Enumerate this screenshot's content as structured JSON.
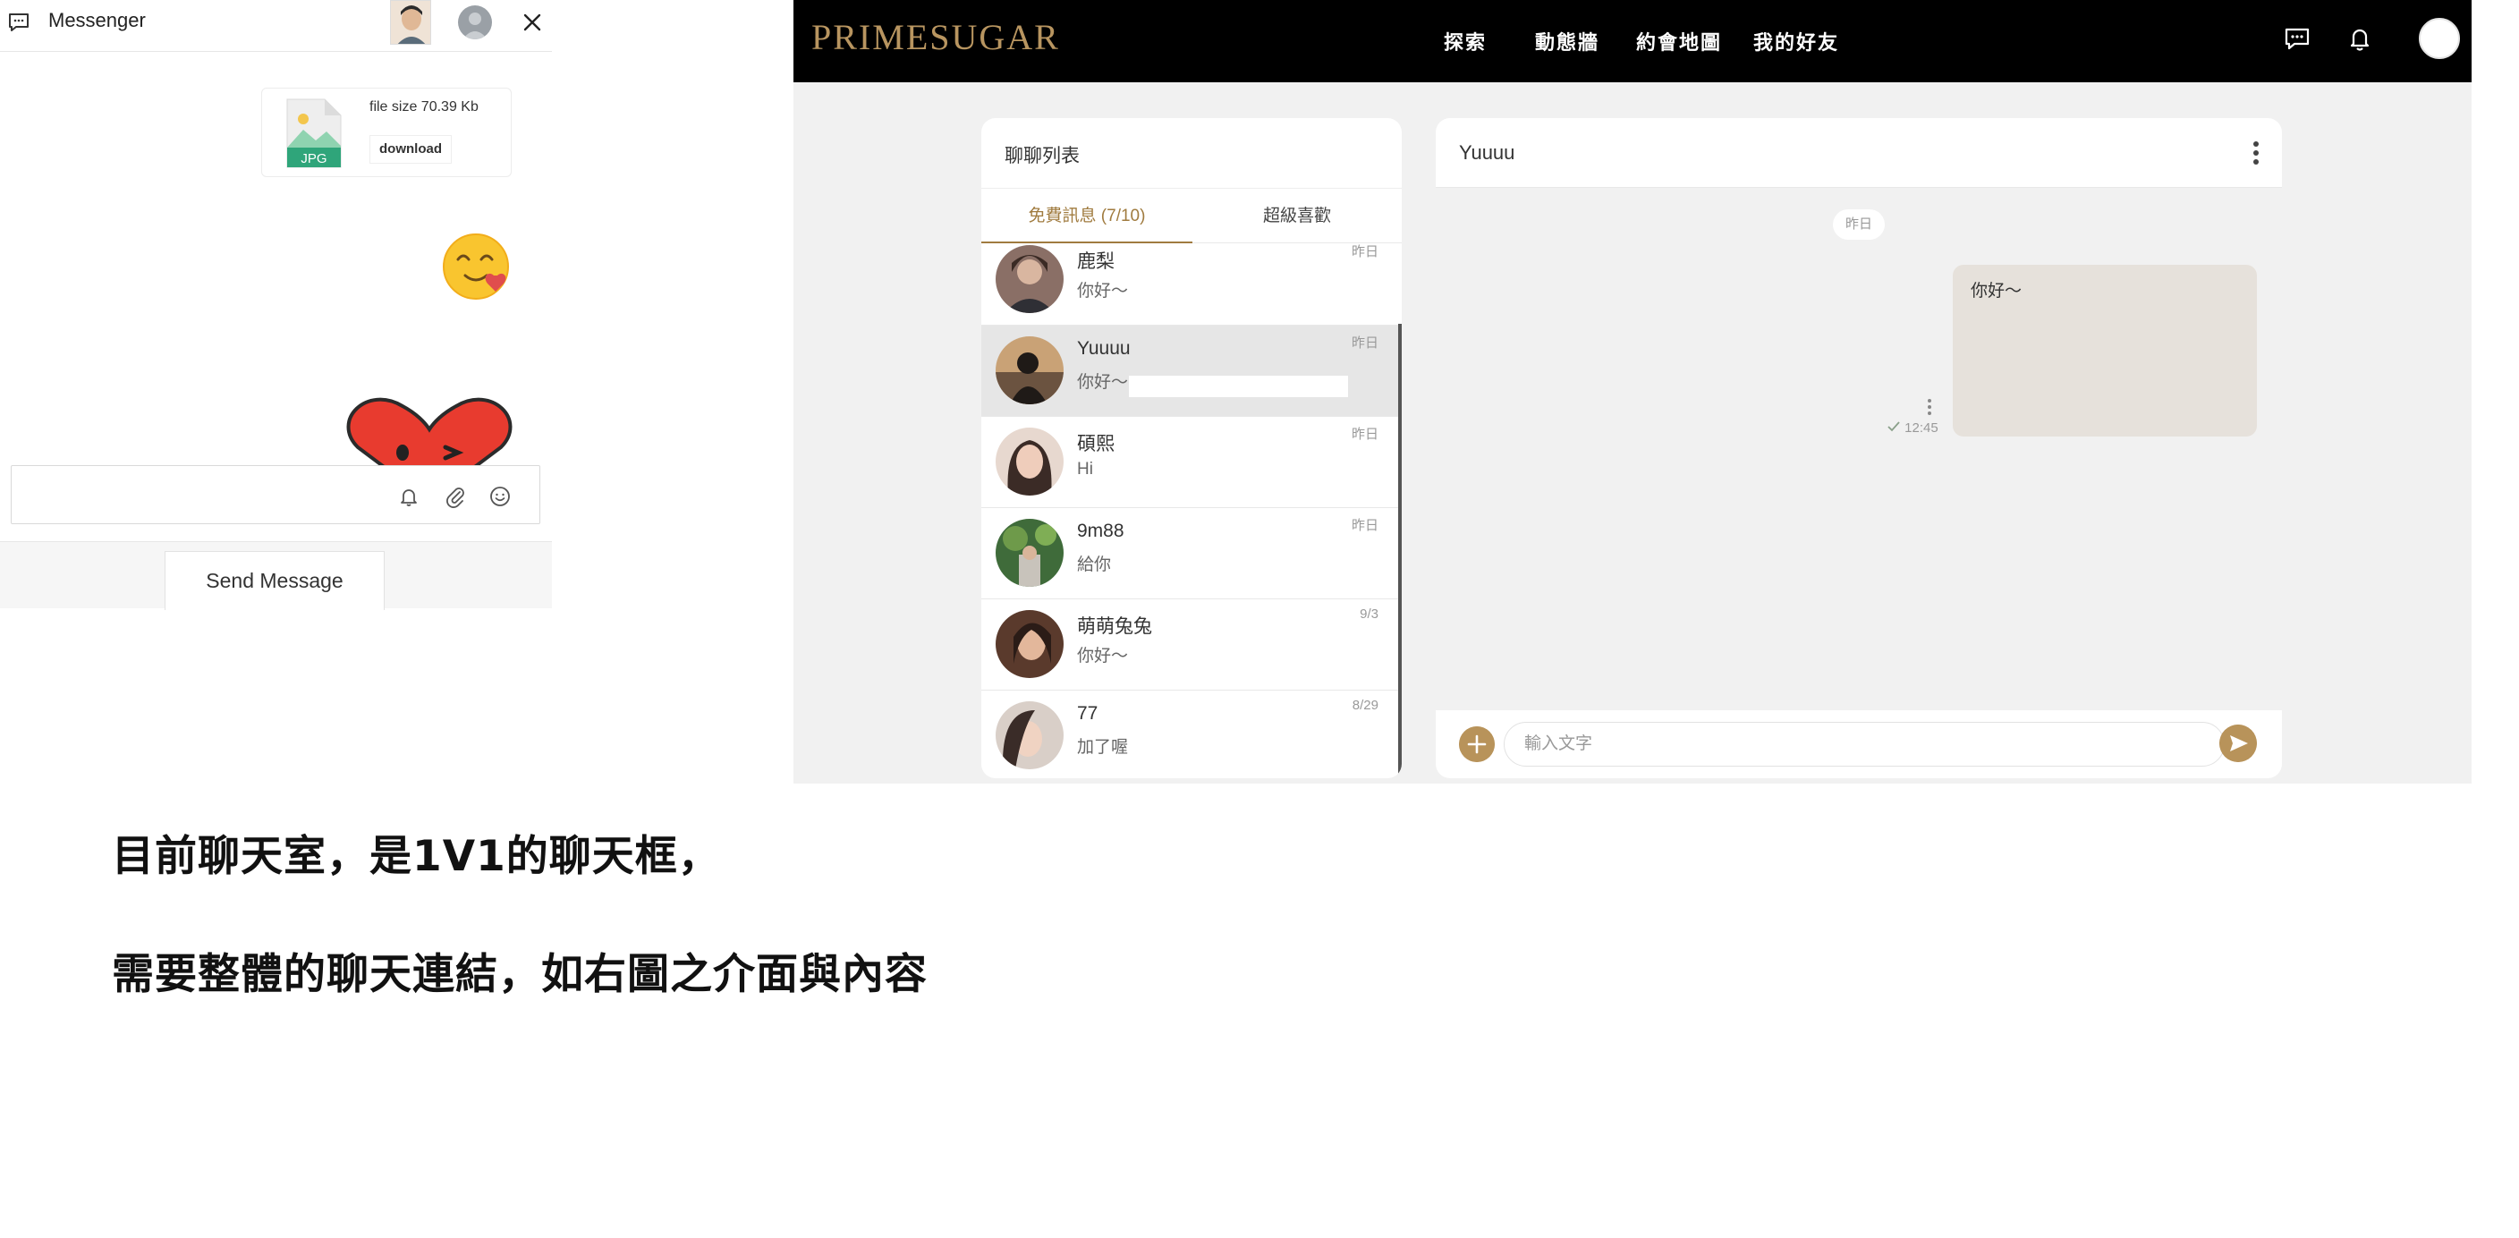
{
  "messenger": {
    "title": "Messenger",
    "file": {
      "badge": "JPG",
      "size_text": "file size 70.39 Kb",
      "download_label": "download"
    },
    "input_value": "",
    "send_label": "Send Message"
  },
  "app": {
    "logo": "PRIMESUGAR",
    "nav": [
      "探索",
      "動態牆",
      "約會地圖",
      "我的好友"
    ],
    "colors": {
      "brand": "#b8935a",
      "topbar": "#000000",
      "tab_active": "#a07b3f"
    },
    "list_panel": {
      "title": "聊聊列表",
      "tabs": [
        {
          "label": "免費訊息 (7/10)",
          "active": true
        },
        {
          "label": "超級喜歡",
          "active": false
        }
      ],
      "conversations": [
        {
          "name": "鹿梨",
          "message": "你好～",
          "date": "昨日",
          "selected": false
        },
        {
          "name": "Yuuuu",
          "message": "你好～",
          "date": "昨日",
          "selected": true
        },
        {
          "name": "碩熙",
          "message": "Hi",
          "date": "昨日",
          "selected": false
        },
        {
          "name": "9m88",
          "message": "給你",
          "date": "昨日",
          "selected": false
        },
        {
          "name": "萌萌兔兔",
          "message": "你好～",
          "date": "9/3",
          "selected": false
        },
        {
          "name": "77",
          "message": "加了喔",
          "date": "8/29",
          "selected": false
        }
      ]
    },
    "chat_panel": {
      "contact_name": "Yuuuu",
      "day_label": "昨日",
      "message": {
        "text": "你好～",
        "time": "12:45",
        "status": "read-check"
      },
      "input_placeholder": "輸入文字"
    }
  },
  "captions": [
    "目前聊天室，是1V1的聊天框，",
    "需要整體的聊天連結，如右圖之介面與內容"
  ]
}
